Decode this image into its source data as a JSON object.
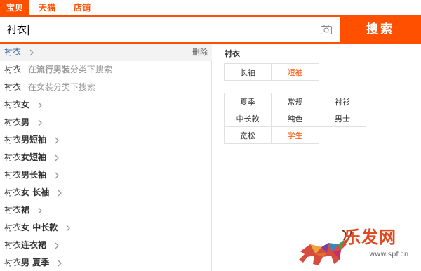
{
  "tabs": [
    "宝贝",
    "天猫",
    "店铺"
  ],
  "search": {
    "value": "衬衣|",
    "button_label": "搜索"
  },
  "suggestions": {
    "delete_label": "删除",
    "items": [
      {
        "text": "衬衣",
        "bold": "",
        "hint": "",
        "hint_bold": "",
        "hint_tail": ""
      },
      {
        "text": "衬衣",
        "bold": "",
        "hint": "在",
        "hint_bold": "流行男装",
        "hint_tail": "分类下搜索"
      },
      {
        "text": "衬衣",
        "bold": "",
        "hint": "在女装分类下搜索",
        "hint_bold": "",
        "hint_tail": ""
      },
      {
        "text": "衬衣",
        "bold": "女",
        "hint": "",
        "hint_bold": "",
        "hint_tail": ""
      },
      {
        "text": "衬衣",
        "bold": "男",
        "hint": "",
        "hint_bold": "",
        "hint_tail": ""
      },
      {
        "text": "衬衣",
        "bold": "男短袖",
        "hint": "",
        "hint_bold": "",
        "hint_tail": ""
      },
      {
        "text": "衬衣",
        "bold": "女短袖",
        "hint": "",
        "hint_bold": "",
        "hint_tail": ""
      },
      {
        "text": "衬衣",
        "bold": "男长袖",
        "hint": "",
        "hint_bold": "",
        "hint_tail": ""
      },
      {
        "text": "衬衣",
        "bold": "女 长袖",
        "hint": "",
        "hint_bold": "",
        "hint_tail": ""
      },
      {
        "text": "衬衣",
        "bold": "裙",
        "hint": "",
        "hint_bold": "",
        "hint_tail": ""
      },
      {
        "text": "衬衣",
        "bold": "女 中长款",
        "hint": "",
        "hint_bold": "",
        "hint_tail": ""
      },
      {
        "text": "衬衣",
        "bold": "连衣裙",
        "hint": "",
        "hint_bold": "",
        "hint_tail": ""
      },
      {
        "text": "衬衣",
        "bold": "男 夏季",
        "hint": "",
        "hint_bold": "",
        "hint_tail": ""
      }
    ]
  },
  "panel": {
    "title": "衬衣",
    "sleeve": [
      "长袖",
      "短袖"
    ],
    "attrs": [
      "夏季",
      "常规",
      "衬衫",
      "中长款",
      "纯色",
      "男士",
      "宽松",
      "学生"
    ]
  },
  "watermark": {
    "text": "乐发网",
    "url": "www.spf.cn"
  },
  "colors": {
    "accent": "#ff5000",
    "link": "#3c6ca8",
    "highlight": "#ff5000"
  }
}
